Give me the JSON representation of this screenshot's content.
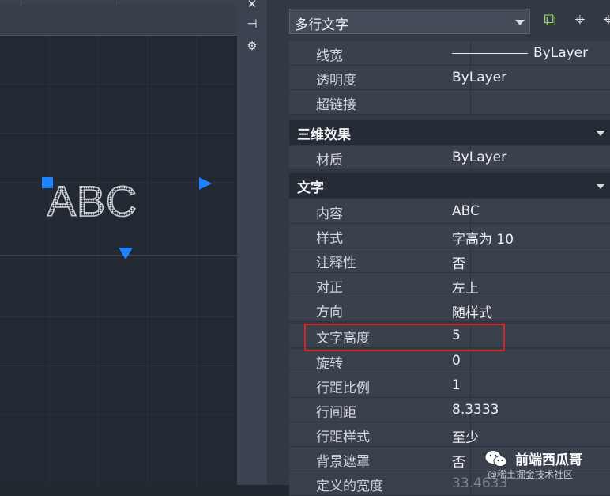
{
  "canvas": {
    "text": "ABC",
    "grip_color": "#1f83ff"
  },
  "side_strip": {
    "icons": [
      "close-icon",
      "auto-hide-icon",
      "settings-icon"
    ],
    "glyphs": [
      "✕",
      "⊣",
      "⚙"
    ]
  },
  "properties": {
    "object_select": "多行文字",
    "toolbar_glyphs": [
      "⧉",
      "⌖",
      "⌖"
    ],
    "general_rows": [
      {
        "name": "线宽",
        "value": "ByLayer",
        "has_line_sample": true
      },
      {
        "name": "透明度",
        "value": "ByLayer"
      },
      {
        "name": "超链接",
        "value": ""
      }
    ],
    "cat_3d": "三维效果",
    "rows_3d": [
      {
        "name": "材质",
        "value": "ByLayer"
      }
    ],
    "cat_text": "文字",
    "text_rows": [
      {
        "name": "内容",
        "value": "ABC"
      },
      {
        "name": "样式",
        "value": "字高为 10"
      },
      {
        "name": "注释性",
        "value": "否"
      },
      {
        "name": "对正",
        "value": "左上"
      },
      {
        "name": "方向",
        "value": "随样式"
      },
      {
        "name": "文字高度",
        "value": "5"
      },
      {
        "name": "旋转",
        "value": "0"
      },
      {
        "name": "行距比例",
        "value": "1"
      },
      {
        "name": "行间距",
        "value": "8.3333"
      },
      {
        "name": "行距样式",
        "value": "至少"
      },
      {
        "name": "背景遮罩",
        "value": "否"
      },
      {
        "name": "定义的宽度",
        "value": "33.4633"
      }
    ],
    "highlight_color": "#d7222b"
  },
  "watermark": {
    "name": "前端西瓜哥",
    "credit": "@稀土掘金技术社区"
  }
}
